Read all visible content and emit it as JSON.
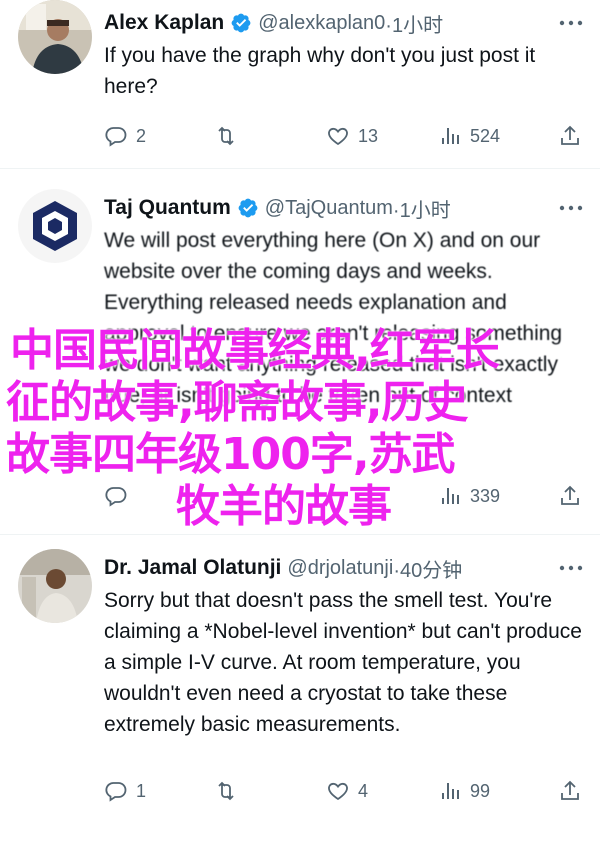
{
  "tweets": [
    {
      "name": "Alex Kaplan",
      "handle": "@alexkaplan0",
      "time": "·1小时",
      "text": "If you have the graph why don't you just post it here?",
      "replies": "2",
      "retweets": "",
      "likes": "13",
      "views": "524"
    },
    {
      "name": "Taj Quantum",
      "handle": "@TajQuantum",
      "time": "·1小时",
      "text": "We will post everything here (On X) and on our website over the coming days and weeks. Everything released needs explanation and approval to ensure we aren't releasing something we don't want anything released that isn't exactly true, or isn't going to be taken out of context",
      "replies": "",
      "retweets": "",
      "likes": "",
      "views": "339"
    },
    {
      "name": "Dr. Jamal Olatunji",
      "handle": "@drjolatunji",
      "time": "·40分钟",
      "text": "Sorry but that doesn't pass the smell test. You're claiming a *Nobel-level invention* but can't produce a simple I-V curve. At room temperature, you wouldn't even need a cryostat to take these extremely basic measurements.",
      "replies": "1",
      "retweets": "",
      "likes": "4",
      "views": "99"
    }
  ],
  "overlay": {
    "line1": "中国民间故事经典,红军长",
    "line2": "征的故事,聊斋故事,历史",
    "line3": "故事四年级100字,苏武",
    "line4": "牧羊的故事"
  },
  "colors": {
    "verified": "#1d9bf0",
    "secondary": "#536471",
    "overlay_text": "#ee22ee"
  },
  "icons": [
    "avatar-photo-icon",
    "quantum-logo-icon",
    "verified-badge-icon",
    "more-icon",
    "reply-icon",
    "retweet-icon",
    "like-icon",
    "views-icon",
    "share-icon"
  ]
}
